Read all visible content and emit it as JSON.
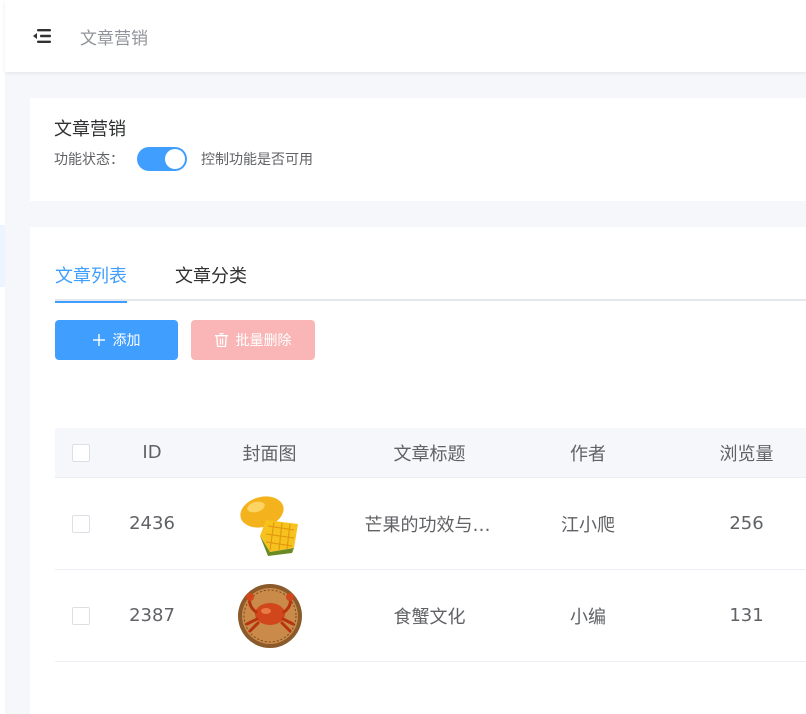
{
  "header": {
    "title": "文章营销",
    "menu_icon": "menu-fold-icon"
  },
  "status_card": {
    "title": "文章营销",
    "status_label": "功能状态：",
    "switch_on": true,
    "switch_desc": "控制功能是否可用"
  },
  "tabs": [
    {
      "label": "文章列表",
      "active": true
    },
    {
      "label": "文章分类",
      "active": false
    }
  ],
  "toolbar": {
    "add_label": "添加",
    "add_icon": "plus-icon",
    "batch_delete_label": "批量删除",
    "batch_delete_icon": "trash-icon"
  },
  "table": {
    "columns": [
      "ID",
      "封面图",
      "文章标题",
      "作者",
      "浏览量"
    ],
    "rows": [
      {
        "id": "2436",
        "cover": "mango-image",
        "title": "芒果的功效与作用",
        "author": "江小爬",
        "views": "256"
      },
      {
        "id": "2387",
        "cover": "crab-image",
        "title": "食蟹文化",
        "author": "小编",
        "views": "131"
      }
    ]
  },
  "colors": {
    "primary": "#409eff",
    "danger_disabled": "#fab6b6",
    "page_bg": "#f5f7fa"
  }
}
